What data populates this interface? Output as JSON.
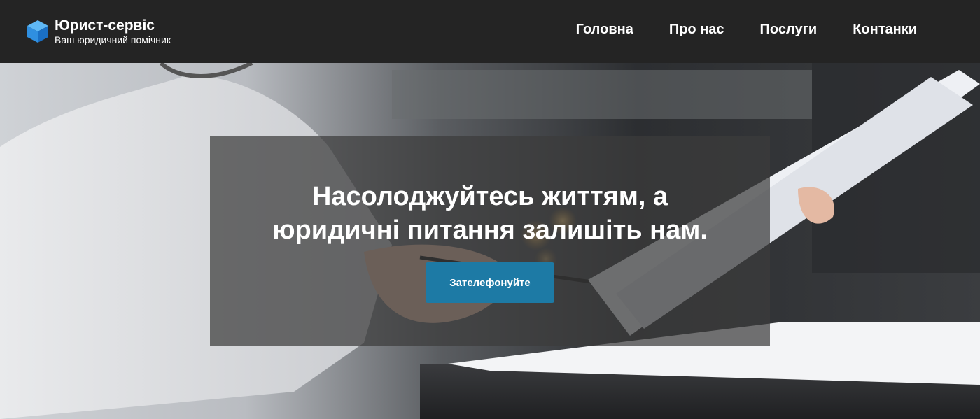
{
  "brand": {
    "title": "Юрист-сервіс",
    "tagline": "Ваш юридичний помічник",
    "logo_icon": "cube-icon",
    "logo_color": "#2f8fe0"
  },
  "nav": {
    "items": [
      {
        "label": "Головна"
      },
      {
        "label": "Про нас"
      },
      {
        "label": "Послуги"
      },
      {
        "label": "Контанки"
      }
    ]
  },
  "hero": {
    "background": "photo of a woman in a white shirt holding a pen and reviewing documents",
    "title_line1": "Насолоджуйтесь життям, а",
    "title_line2": "юридичні питання залишіть нам.",
    "cta_label": "Зателефонуйте",
    "cta_color": "#1d7aa5"
  },
  "colors": {
    "header_bg": "#242424",
    "overlay": "rgba(60,60,60,0.72)"
  }
}
